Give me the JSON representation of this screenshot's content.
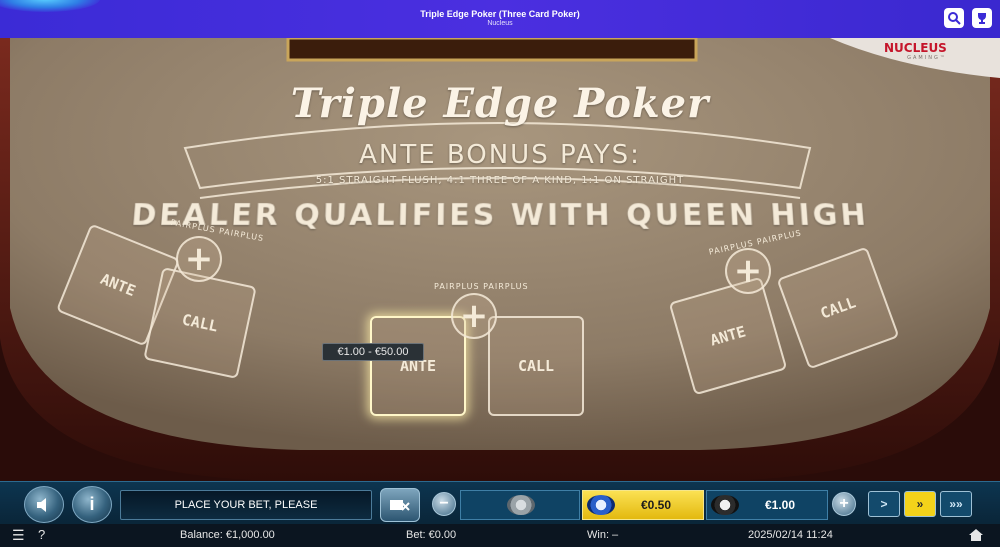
{
  "topbar": {
    "title": "Triple Edge Poker (Three Card Poker)",
    "subtitle": "Nucleus",
    "search_icon": "search-icon",
    "trophy_icon": "trophy-icon"
  },
  "table": {
    "title": "Triple Edge Poker",
    "ante_bonus": "ANTE BONUS PAYS:",
    "pays_line": "5:1 STRAIGHT FLUSH, 4:1 THREE OF A KIND, 1:1 ON STRAIGHT",
    "dealer_rule": "DEALER QUALIFIES WITH QUEEN HIGH",
    "pairplus_label": "PAIRPLUS PAIRPLUS",
    "ante_label": "ANTE",
    "call_label": "CALL",
    "plus_symbol": "+",
    "bet_range_tooltip": "€1.00 - €50.00",
    "logo_text": "NUCLEUS",
    "logo_sub": "GAMING™",
    "felt_color": "#9c8a74",
    "rail_color": "#4a1a14"
  },
  "controls": {
    "message": "PLACE YOUR BET, PLEASE",
    "minus_symbol": "−",
    "plus_symbol": "+",
    "info_symbol": "i",
    "chip_left_value": "€0.50",
    "chip_right_value": "€1.00",
    "next_symbol": ">",
    "fast_symbol": "»",
    "faster_symbol": "»»",
    "accent_color": "#f3d21a"
  },
  "status": {
    "balance": "Balance: €1,000.00",
    "bet": "Bet: €0.00",
    "win": "Win: –",
    "datetime": "2025/02/14 11:24",
    "menu_symbol": "☰",
    "help_symbol": "?"
  }
}
